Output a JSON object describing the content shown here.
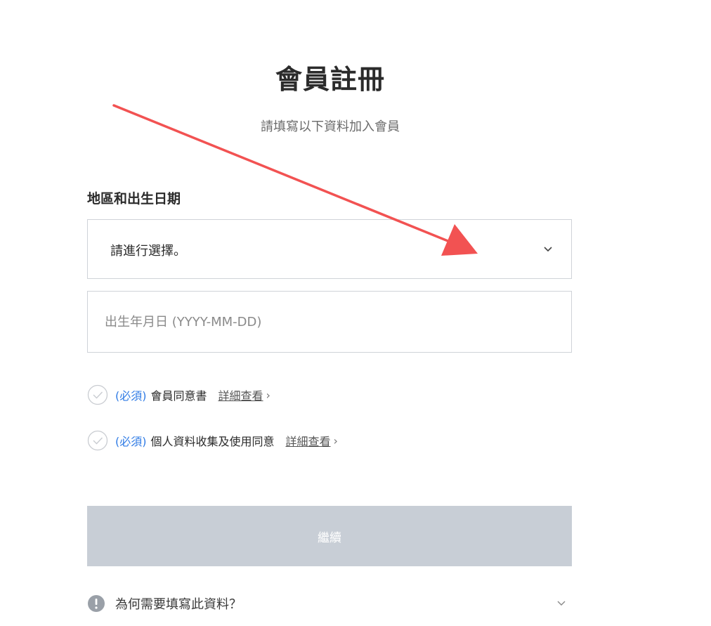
{
  "header": {
    "title": "會員註冊",
    "subtitle": "請填寫以下資料加入會員"
  },
  "form": {
    "section_label": "地區和出生日期",
    "region_select": {
      "selected_value": "請進行選擇。"
    },
    "birthdate": {
      "placeholder": "出生年月日 (YYYY-MM-DD)",
      "value": ""
    },
    "agreements": [
      {
        "required_label": "(必須)",
        "text": "會員同意書",
        "detail_link": "詳細查看",
        "checked": false
      },
      {
        "required_label": "(必須)",
        "text": "個人資料收集及使用同意",
        "detail_link": "詳細查看",
        "checked": false
      }
    ],
    "continue_label": "繼續"
  },
  "help": {
    "why_label": "為何需要填寫此資料？"
  },
  "colors": {
    "accent_blue": "#2f7be5",
    "button_disabled": "#c8ced6",
    "annotation_red": "#f25252",
    "border": "#cfd3d8"
  },
  "icons": {
    "dropdown": "chevron-down-icon",
    "check": "check-circle-icon",
    "info": "info-icon",
    "link_arrow": "chevron-right-icon"
  }
}
